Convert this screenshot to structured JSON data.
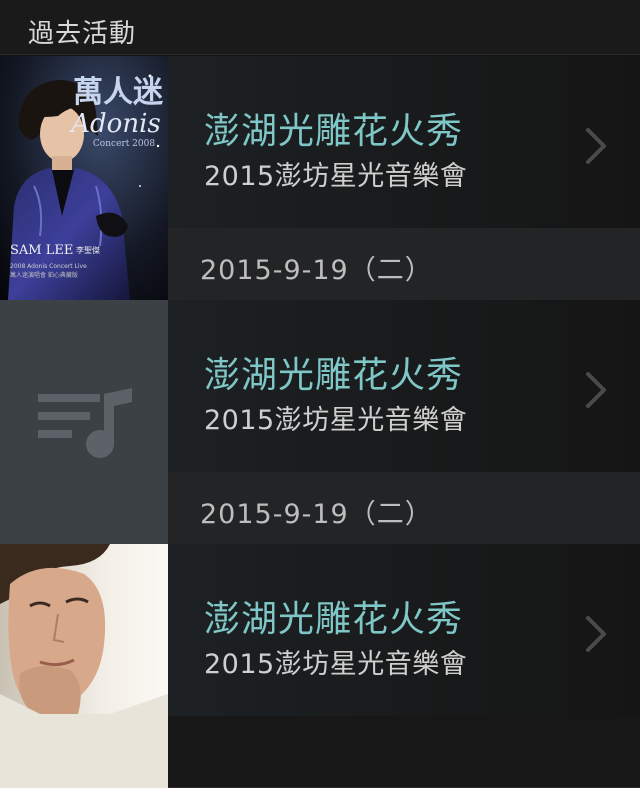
{
  "header": {
    "title": "過去活動"
  },
  "events": [
    {
      "title": "澎湖光雕花火秀",
      "subtitle": "2015澎坊星光音樂會",
      "date": "2015-9-19（二）",
      "thumbnail": {
        "kind": "album-cover",
        "logo_text": "萬人迷 Adonis",
        "concert_text": "Concert 2008",
        "artist": "SAM LEE 李聖傑"
      }
    },
    {
      "title": "澎湖光雕花火秀",
      "subtitle": "2015澎坊星光音樂會",
      "date": "2015-9-19（二）",
      "thumbnail": {
        "kind": "placeholder",
        "icon": "music-list-icon"
      }
    },
    {
      "title": "澎湖光雕花火秀",
      "subtitle": "2015澎坊星光音樂會",
      "date": "",
      "thumbnail": {
        "kind": "portrait-photo"
      }
    }
  ],
  "colors": {
    "accent_title": "#7fc6c6",
    "background": "#141414",
    "date_bar": "#222426"
  }
}
